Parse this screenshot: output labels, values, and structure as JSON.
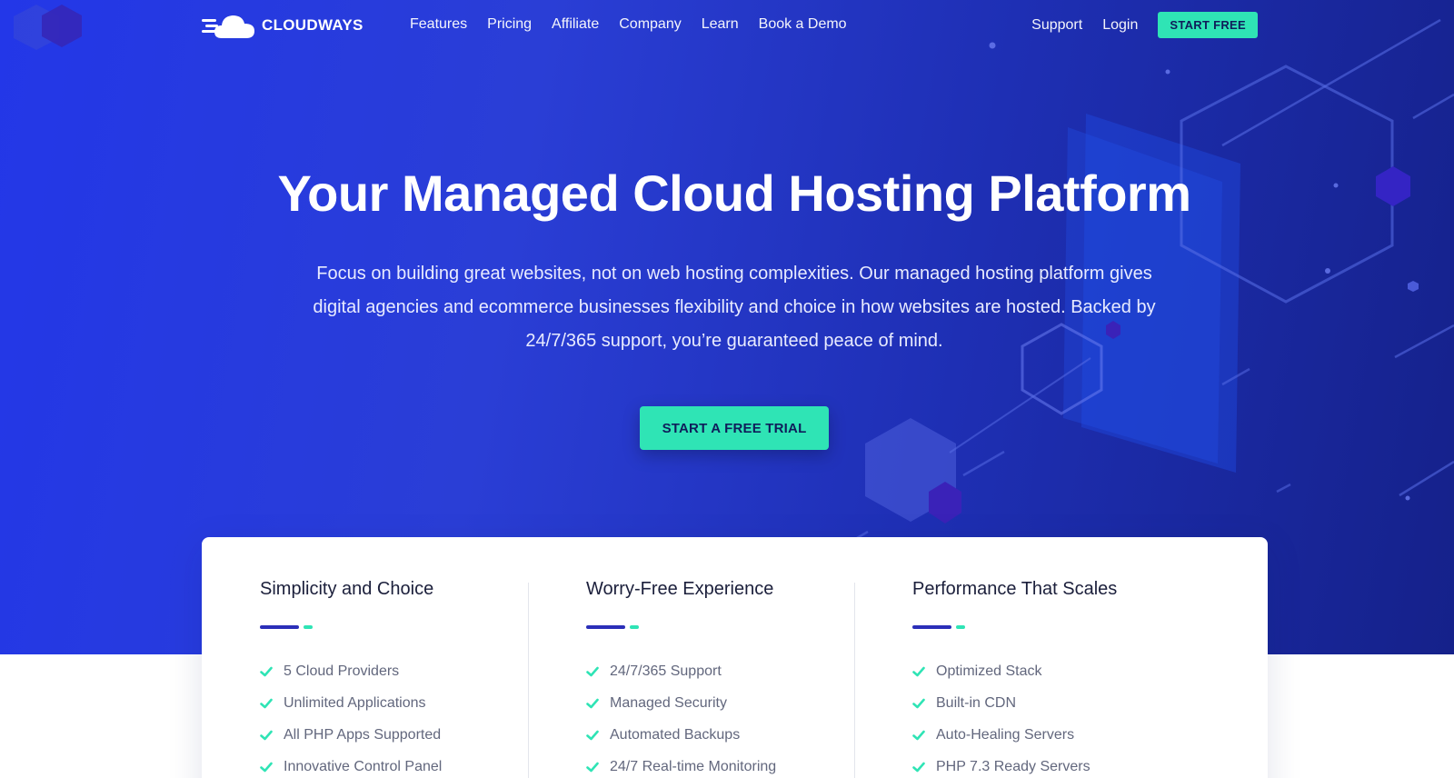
{
  "brand": {
    "name": "CLOUDWAYS"
  },
  "nav": {
    "links": [
      "Features",
      "Pricing",
      "Affiliate",
      "Company",
      "Learn",
      "Book a Demo"
    ],
    "support": "Support",
    "login": "Login",
    "start_free": "START FREE"
  },
  "hero": {
    "title": "Your Managed Cloud Hosting Platform",
    "description": "Focus on building great websites, not on web hosting complexities. Our managed hosting platform gives digital agencies and ecommerce businesses flexibility and choice in how websites are hosted. Backed by 24/7/365 support, you’re guaranteed peace of mind.",
    "cta": "START A FREE TRIAL"
  },
  "features": [
    {
      "title": "Simplicity and Choice",
      "items": [
        "5 Cloud Providers",
        "Unlimited Applications",
        "All PHP Apps Supported",
        "Innovative Control Panel"
      ]
    },
    {
      "title": "Worry-Free Experience",
      "items": [
        "24/7/365 Support",
        "Managed Security",
        "Automated Backups",
        "24/7 Real-time Monitoring"
      ]
    },
    {
      "title": "Performance That Scales",
      "items": [
        "Optimized Stack",
        "Built-in CDN",
        "Auto-Healing Servers",
        "PHP 7.3 Ready Servers"
      ]
    }
  ],
  "colors": {
    "accent_green": "#2fe4b5",
    "accent_blue": "#2b2fb8",
    "hero_start": "#2337e8",
    "hero_end": "#15218a"
  },
  "icons": {
    "logo": "cloud-icon",
    "check": "check-icon"
  }
}
